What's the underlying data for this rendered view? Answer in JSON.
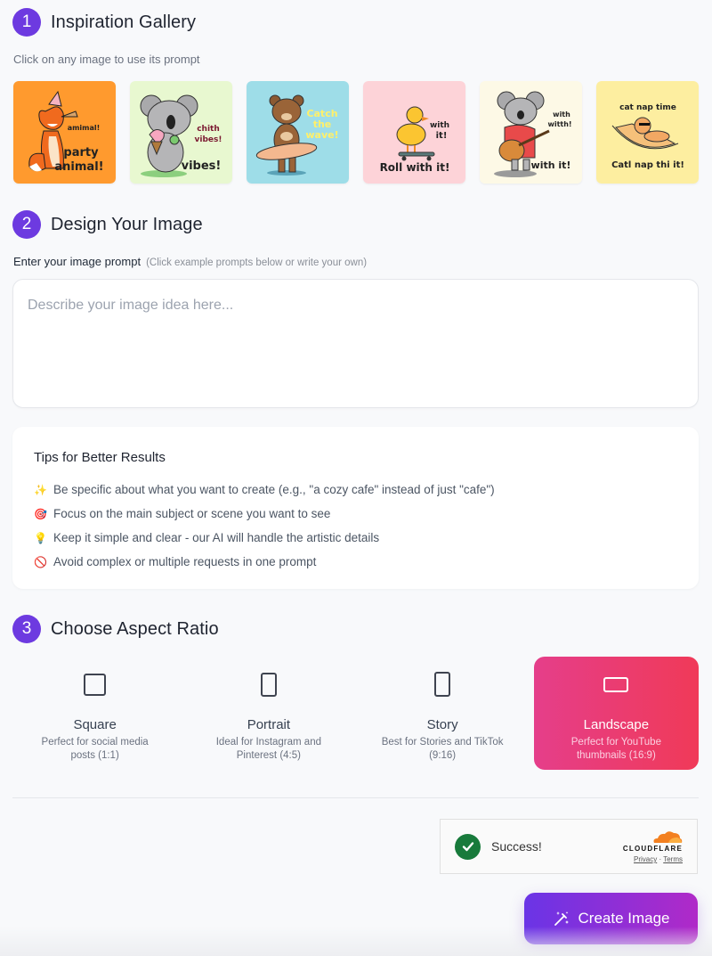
{
  "sections": {
    "gallery": {
      "step": "1",
      "title": "Inspiration Gallery",
      "hint": "Click on any image to use its prompt"
    },
    "design": {
      "step": "2",
      "title": "Design Your Image"
    },
    "ratio": {
      "step": "3",
      "title": "Choose Aspect Ratio"
    }
  },
  "gallery": {
    "items": [
      {
        "subject": "fox with party hat",
        "bg": "#ff9a2e",
        "texts": [
          "amimal!",
          "party",
          "animal!"
        ]
      },
      {
        "subject": "koala with ice cream",
        "bg": "#e8f8d0",
        "texts": [
          "chith",
          "vibes!",
          "vibes!"
        ]
      },
      {
        "subject": "bear with surfboard",
        "bg": "#9edde8",
        "texts": [
          "Catch",
          "the",
          "wave!"
        ]
      },
      {
        "subject": "duck on skateboard",
        "bg": "#fdd3d8",
        "texts": [
          "with",
          "it!",
          "Roll with it!"
        ]
      },
      {
        "subject": "koala with guitar",
        "bg": "#fdf9e6",
        "texts": [
          "with",
          "witth!",
          "with it!"
        ]
      },
      {
        "subject": "cat in hammock",
        "bg": "#fdeea0",
        "texts": [
          "cat nap time",
          "Catl nap thi it!"
        ]
      }
    ]
  },
  "prompt": {
    "label": "Enter your image prompt",
    "sublabel": "(Click example prompts below or write your own)",
    "placeholder": "Describe your image idea here...",
    "value": ""
  },
  "tips": {
    "title": "Tips for Better Results",
    "items": [
      {
        "icon": "sparkles",
        "glyph": "✨",
        "text": "Be specific about what you want to create (e.g., \"a cozy cafe\" instead of just \"cafe\")"
      },
      {
        "icon": "target",
        "glyph": "🎯",
        "text": "Focus on the main subject or scene you want to see"
      },
      {
        "icon": "lightbulb",
        "glyph": "💡",
        "text": "Keep it simple and clear - our AI will handle the artistic details"
      },
      {
        "icon": "prohibited",
        "glyph": "🚫",
        "text": "Avoid complex or multiple requests in one prompt"
      }
    ]
  },
  "ratios": {
    "selected": "landscape",
    "items": [
      {
        "id": "square",
        "name": "Square",
        "desc": "Perfect for social media posts (1:1)"
      },
      {
        "id": "portrait",
        "name": "Portrait",
        "desc": "Ideal for Instagram and Pinterest (4:5)"
      },
      {
        "id": "story",
        "name": "Story",
        "desc": "Best for Stories and TikTok (9:16)"
      },
      {
        "id": "landscape",
        "name": "Landscape",
        "desc": "Perfect for YouTube thumbnails (16:9)"
      }
    ]
  },
  "captcha": {
    "status": "Success!",
    "provider": "CLOUDFLARE",
    "privacy_label": "Privacy",
    "separator": "·",
    "terms_label": "Terms"
  },
  "create_button": {
    "label": "Create Image"
  },
  "colors": {
    "accent": "#6d3ae0",
    "selected_gradient_start": "#e53e8a",
    "selected_gradient_end": "#f03a58",
    "button_gradient_start": "#6a34e6",
    "button_gradient_end": "#b02ac8",
    "success": "#187a3b",
    "cloudflare_orange": "#f38020"
  }
}
